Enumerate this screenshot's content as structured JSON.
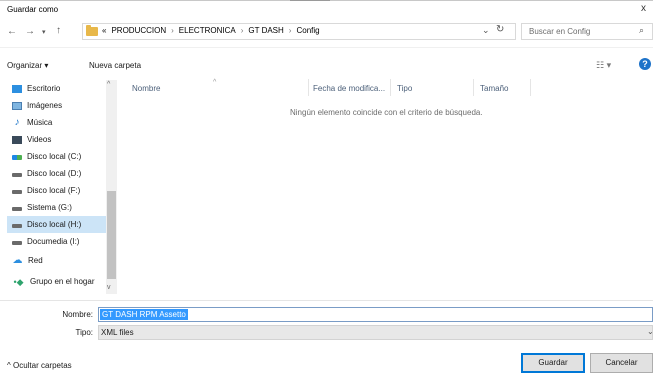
{
  "window": {
    "title": "Guardar como",
    "close_glyph": "x"
  },
  "address": {
    "breadcrumb_prefix": "«",
    "breadcrumbs": [
      "PRODUCCION",
      "ELECTRONICA",
      "GT DASH",
      "Config"
    ],
    "search_placeholder": "Buscar en Config"
  },
  "toolbar": {
    "organize_label": "Organizar ▾",
    "new_folder_label": "Nueva carpeta",
    "help_label": "?"
  },
  "nav_pane": {
    "items": [
      {
        "label": "Escritorio",
        "icon": "desktop-icon"
      },
      {
        "label": "Imágenes",
        "icon": "images-icon"
      },
      {
        "label": "Música",
        "icon": "music-icon"
      },
      {
        "label": "Videos",
        "icon": "videos-icon"
      },
      {
        "label": "Disco local (C:)",
        "icon": "disk-c-icon"
      },
      {
        "label": "Disco local (D:)",
        "icon": "disk-icon"
      },
      {
        "label": "Disco local (F:)",
        "icon": "disk-icon"
      },
      {
        "label": "Sistema (G:)",
        "icon": "disk-icon"
      },
      {
        "label": "Disco local (H:)",
        "icon": "disk-icon",
        "selected": true
      },
      {
        "label": "Documedia (I:)",
        "icon": "disk-icon"
      },
      {
        "label": "Red",
        "icon": "network-icon"
      },
      {
        "label": "Grupo en el hogar",
        "icon": "homegroup-icon"
      }
    ]
  },
  "file_list": {
    "columns": [
      "Nombre",
      "Fecha de modifica...",
      "Tipo",
      "Tamaño"
    ],
    "empty_message": "Ningún elemento coincide con el criterio de búsqueda."
  },
  "save_form": {
    "name_label": "Nombre:",
    "name_value": "GT DASH RPM Assetto",
    "type_label": "Tipo:",
    "type_value": "XML files"
  },
  "footer": {
    "hide_folders_label": "^  Ocultar carpetas",
    "save_button": "Guardar",
    "cancel_button": "Cancelar"
  },
  "colors": {
    "accent": "#0078d7",
    "selection": "#3399ff",
    "nav_selected": "#cce4f7"
  }
}
